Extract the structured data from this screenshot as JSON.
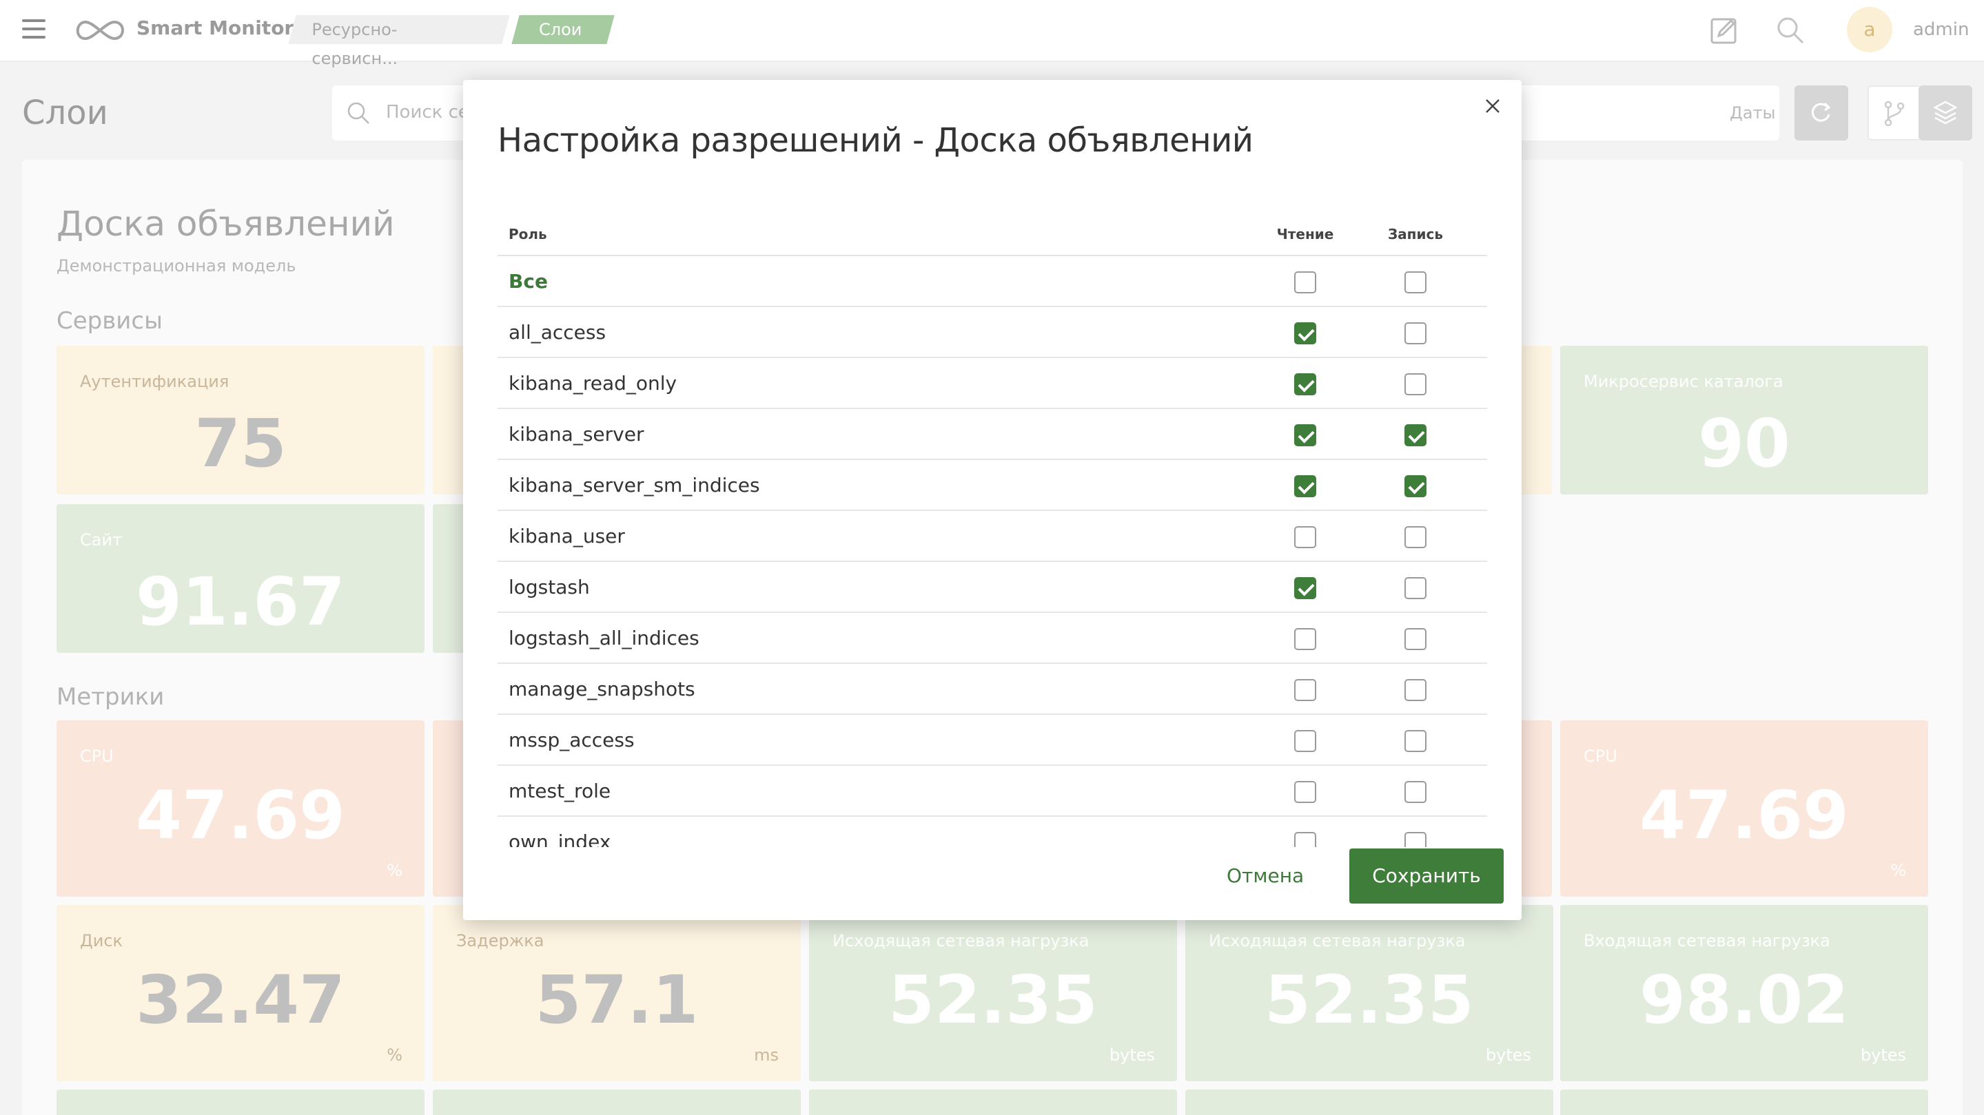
{
  "header": {
    "app_name": "Smart Monitor",
    "breadcrumbs": [
      "Ресурсно-сервисн...",
      "Слои"
    ],
    "user_initial": "a",
    "user_name": "admin"
  },
  "page": {
    "title": "Слои",
    "search_placeholder": "Поиск сер",
    "dates_label": "Даты"
  },
  "dashboard": {
    "title": "Доска объявлений",
    "subtitle": "Демонстрационная модель",
    "services_heading": "Сервисы",
    "metrics_heading": "Метрики",
    "tiles": [
      {
        "label": "Аутентификация",
        "value": "75",
        "unit": "",
        "color": "yellow"
      },
      {
        "label": "Микросервис каталога",
        "value": "90",
        "unit": "",
        "color": "green"
      },
      {
        "label": "Сайт",
        "value": "91.67",
        "unit": "",
        "color": "green"
      },
      {
        "label": "CPU",
        "value": "47.69",
        "unit": "%",
        "color": "orange"
      },
      {
        "label": "CPU",
        "value": "47.69",
        "unit": "%",
        "color": "orange"
      },
      {
        "label": "Диск",
        "value": "32.47",
        "unit": "%",
        "color": "yellow"
      },
      {
        "label": "Задержка",
        "value": "57.1",
        "unit": "ms",
        "color": "yellow"
      },
      {
        "label": "Исходящая сетевая нагрузка",
        "value": "52.35",
        "unit": "bytes",
        "color": "green"
      },
      {
        "label": "Исходящая сетевая нагрузка",
        "value": "52.35",
        "unit": "bytes",
        "color": "green"
      },
      {
        "label": "Входящая сетевая нагрузка",
        "value": "98.02",
        "unit": "bytes",
        "color": "green"
      }
    ]
  },
  "modal": {
    "title": "Настройка разрешений - Доска объявлений",
    "columns": {
      "role": "Роль",
      "read": "Чтение",
      "write": "Запись"
    },
    "rows": [
      {
        "role": "Все",
        "read": false,
        "write": false
      },
      {
        "role": "all_access",
        "read": true,
        "write": false
      },
      {
        "role": "kibana_read_only",
        "read": true,
        "write": false
      },
      {
        "role": "kibana_server",
        "read": true,
        "write": true
      },
      {
        "role": "kibana_server_sm_indices",
        "read": true,
        "write": true
      },
      {
        "role": "kibana_user",
        "read": false,
        "write": false
      },
      {
        "role": "logstash",
        "read": true,
        "write": false
      },
      {
        "role": "logstash_all_indices",
        "read": false,
        "write": false
      },
      {
        "role": "manage_snapshots",
        "read": false,
        "write": false
      },
      {
        "role": "mssp_access",
        "read": false,
        "write": false
      },
      {
        "role": "mtest_role",
        "read": false,
        "write": false
      },
      {
        "role": "own_index",
        "read": false,
        "write": false
      }
    ],
    "cancel_label": "Отмена",
    "save_label": "Сохранить"
  },
  "colors": {
    "accent_green": "#3e7d3a",
    "tile_green": "#e2ecdd",
    "tile_yellow": "#fdf3e1",
    "tile_orange": "#fbe6dc"
  }
}
